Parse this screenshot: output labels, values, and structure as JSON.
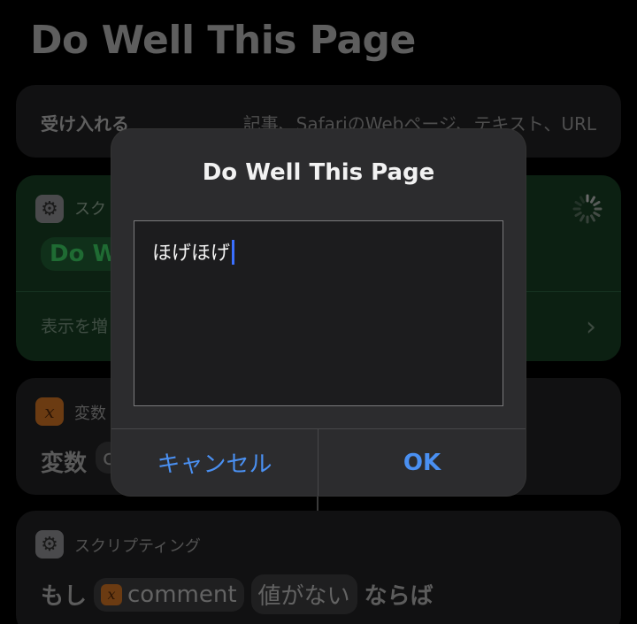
{
  "page": {
    "title": "Do Well This Page"
  },
  "accepts_card": {
    "label": "受け入れる",
    "value": "記事、SafariのWebページ、テキスト、URL"
  },
  "script_card": {
    "header": "スク",
    "action_token": "Do W",
    "show_more": "表示を増"
  },
  "variable_card": {
    "header": "変数",
    "body": "変数",
    "token": "c"
  },
  "if_card": {
    "header": "スクリプティング",
    "prefix": "もし",
    "variable": "comment",
    "condition": "値がない",
    "suffix": "ならば"
  },
  "alert": {
    "title": "Do Well This Page",
    "input_value": "ほげほげ",
    "cancel_label": "キャンセル",
    "ok_label": "OK"
  },
  "colors": {
    "accent": "#4a90f2",
    "caret": "#3a6fff",
    "dialog_bg": "#2c2c2e"
  }
}
